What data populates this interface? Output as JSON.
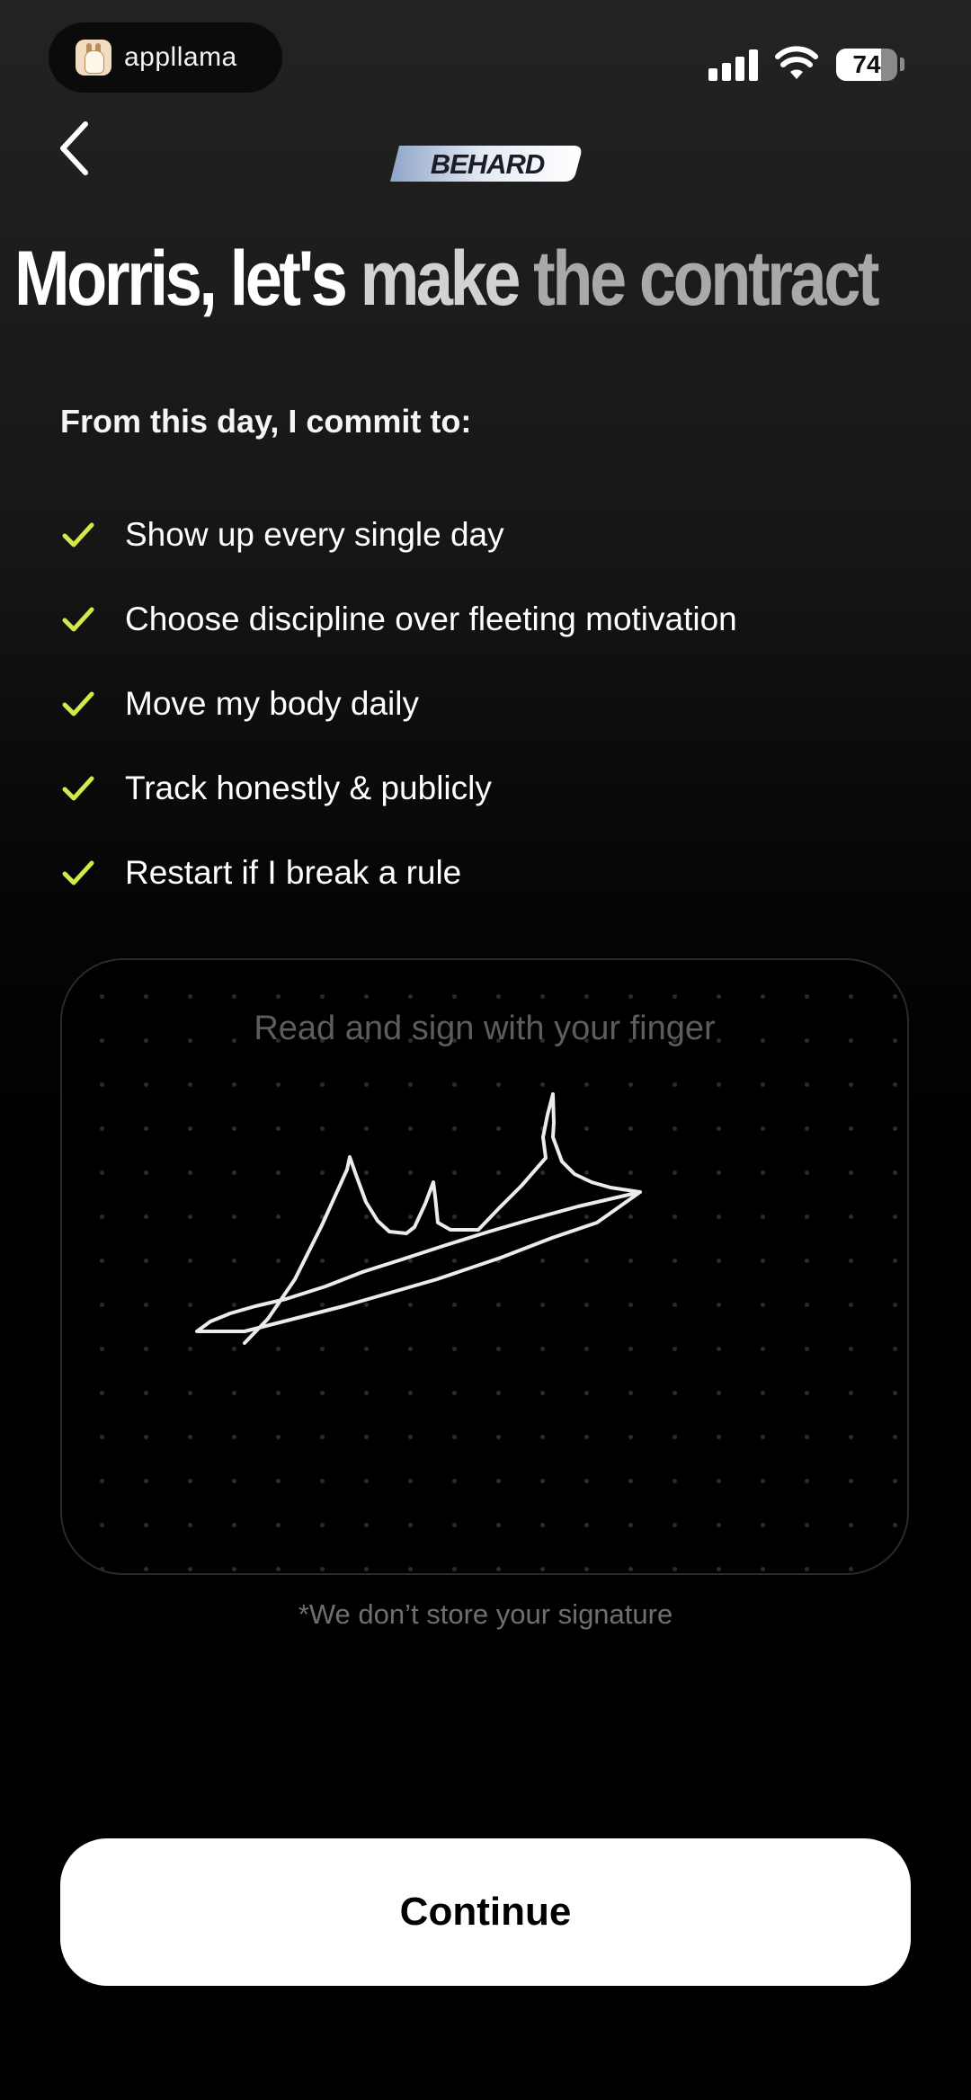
{
  "status_bar": {
    "app_badge_label": "appllama",
    "battery_percent": "74",
    "battery_level": 0.74
  },
  "header": {
    "back_icon": "chevron-left-icon",
    "brand": "BEHARD"
  },
  "headline": {
    "part1": "Morris, let's",
    "part2": "make",
    "part3": "the contract"
  },
  "commitments": {
    "intro": "From this day, I commit to:",
    "check_icon": "checkmark-icon",
    "check_color": "#d4e84a",
    "items": [
      "Show up every single day",
      "Choose discipline over fleeting motivation",
      "Move my body daily",
      "Track honestly & publicly",
      "Restart if I break a rule"
    ]
  },
  "signature": {
    "hint": "Read and sign with your finger",
    "disclaimer": "*We don’t store your signature"
  },
  "continue_label": "Continue"
}
